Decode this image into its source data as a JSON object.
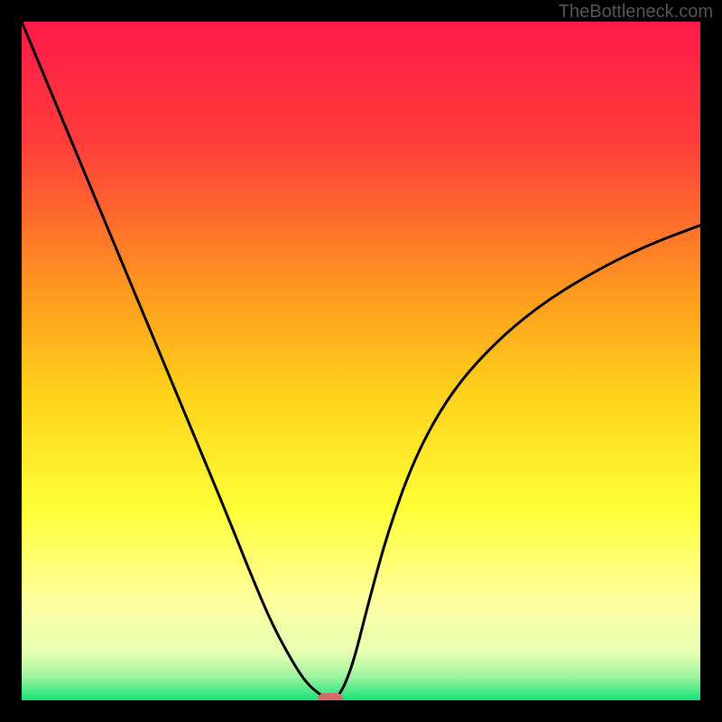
{
  "watermark": "TheBottleneck.com",
  "chart_data": {
    "type": "line",
    "title": "",
    "xlabel": "",
    "ylabel": "",
    "xlim": [
      0,
      1
    ],
    "ylim": [
      0,
      1
    ],
    "background_gradient": {
      "stops": [
        {
          "offset": 0.0,
          "color": "#ff1a4a"
        },
        {
          "offset": 0.18,
          "color": "#ff3e3a"
        },
        {
          "offset": 0.4,
          "color": "#ff9a1e"
        },
        {
          "offset": 0.55,
          "color": "#ffd21c"
        },
        {
          "offset": 0.72,
          "color": "#ffff3a"
        },
        {
          "offset": 0.85,
          "color": "#ffff9e"
        },
        {
          "offset": 0.93,
          "color": "#e6ffb3"
        },
        {
          "offset": 0.965,
          "color": "#9ef5a1"
        },
        {
          "offset": 1.0,
          "color": "#16e07a"
        }
      ]
    },
    "series": [
      {
        "name": "bottleneck-curve",
        "x": [
          0.0,
          0.05,
          0.1,
          0.15,
          0.2,
          0.25,
          0.3,
          0.34,
          0.37,
          0.4,
          0.42,
          0.44,
          0.455,
          0.465,
          0.475,
          0.49,
          0.51,
          0.54,
          0.58,
          0.63,
          0.69,
          0.76,
          0.84,
          0.92,
          1.0
        ],
        "y": [
          1.0,
          0.88,
          0.76,
          0.64,
          0.52,
          0.4,
          0.28,
          0.18,
          0.11,
          0.055,
          0.025,
          0.008,
          0.0,
          0.005,
          0.02,
          0.06,
          0.14,
          0.25,
          0.36,
          0.45,
          0.52,
          0.58,
          0.63,
          0.67,
          0.7
        ]
      }
    ],
    "marker": {
      "name": "min-point",
      "x": 0.455,
      "y": 0.0,
      "color": "#d66a6a",
      "shape": "capsule"
    }
  }
}
